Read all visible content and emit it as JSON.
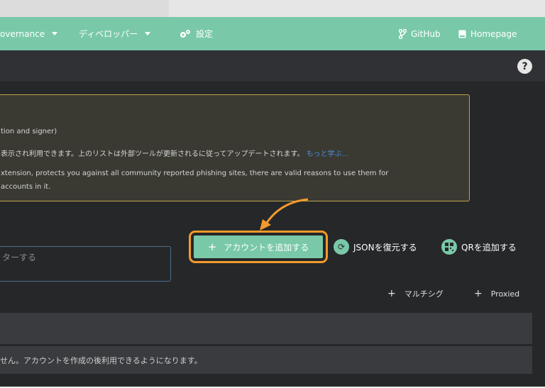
{
  "navbar": {
    "governance_label": "overnance",
    "developer_label": "ディベロッパー",
    "settings_label": "設定",
    "github_label": "GitHub",
    "homepage_label": "Homepage"
  },
  "help": {
    "label": "?"
  },
  "warning": {
    "line1": "tion and signer)",
    "line2_text": "表示され利用できます。上のリストは外部ツールが更新されるに従ってアップデートされます。",
    "line2_link": "もっと学ぶ...",
    "line3": "xtension, protects you against all community reported phishing sites, there are valid reasons to use them for",
    "line4": "accounts in it."
  },
  "filter": {
    "placeholder": "ターする"
  },
  "actions": {
    "add_account": "アカウントを追加する",
    "restore_json": "JSONを復元する",
    "add_qr": "QRを追加する",
    "multisig": "マルチシグ",
    "proxied": "Proxied"
  },
  "list": {
    "empty_message": "せん。アカウントを作成の後利用できるようになります。"
  },
  "colors": {
    "accent": "#79c9a9",
    "highlight": "#f39a2c",
    "warning_border": "#bfa24a",
    "background": "#262729"
  }
}
